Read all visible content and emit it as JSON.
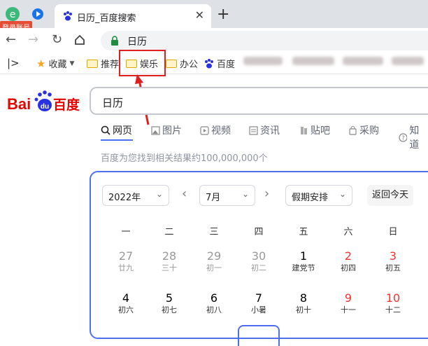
{
  "browser": {
    "login_badge": "登录账号",
    "tab_title": "日历_百度搜索",
    "tab_close": "✕",
    "new_tab": "+",
    "address": "日历"
  },
  "bookmarks": {
    "items": [
      {
        "label": "收藏"
      },
      {
        "label": "推荐"
      },
      {
        "label": "娱乐"
      },
      {
        "label": "办公"
      },
      {
        "label": "百度"
      }
    ]
  },
  "baidu": {
    "logo": "百度",
    "query": "日历",
    "tabs": [
      {
        "label": "网页"
      },
      {
        "label": "图片"
      },
      {
        "label": "视频"
      },
      {
        "label": "资讯"
      },
      {
        "label": "贴吧"
      },
      {
        "label": "采购"
      },
      {
        "label": "知道"
      }
    ],
    "result_count": "百度为您找到相关结果约100,000,000个"
  },
  "calendar": {
    "year": "2022年",
    "month": "7月",
    "holiday": "假期安排",
    "today_button": "返回今天",
    "weekdays": [
      "一",
      "二",
      "三",
      "四",
      "五",
      "六",
      "日"
    ],
    "rows": [
      [
        {
          "day": "27",
          "lunar": "廿九",
          "other": true
        },
        {
          "day": "28",
          "lunar": "三十",
          "other": true
        },
        {
          "day": "29",
          "lunar": "初一",
          "other": true
        },
        {
          "day": "30",
          "lunar": "初二",
          "other": true
        },
        {
          "day": "1",
          "lunar": "建党节"
        },
        {
          "day": "2",
          "lunar": "初四",
          "weekend": true
        },
        {
          "day": "3",
          "lunar": "初五",
          "weekend": true
        }
      ],
      [
        {
          "day": "4",
          "lunar": "初六"
        },
        {
          "day": "5",
          "lunar": "初七"
        },
        {
          "day": "6",
          "lunar": "初八"
        },
        {
          "day": "7",
          "lunar": "小暑"
        },
        {
          "day": "8",
          "lunar": "初十"
        },
        {
          "day": "9",
          "lunar": "十一",
          "weekend": true
        },
        {
          "day": "10",
          "lunar": "十二",
          "weekend": true
        }
      ]
    ]
  },
  "colors": {
    "baidu_blue": "#4e6ef2",
    "baidu_red": "#e10602",
    "weekend_red": "#f73131",
    "highlight_red": "#e02020"
  }
}
